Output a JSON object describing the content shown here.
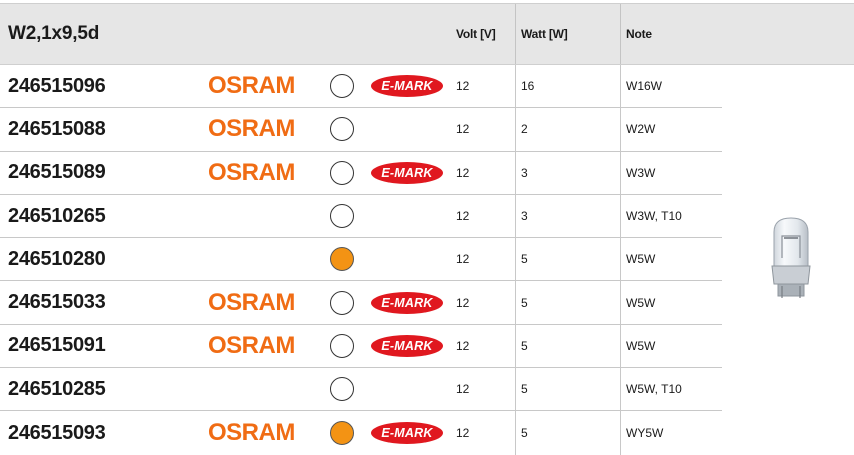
{
  "header": {
    "title": "W2,1x9,5d",
    "volt_label": "Volt [V]",
    "watt_label": "Watt [W]",
    "note_label": "Note"
  },
  "rows": [
    {
      "part": "246515096",
      "brand": "OSRAM",
      "circle": "empty",
      "emark": "E-MARK",
      "volt": "12",
      "watt": "16",
      "note": "W16W"
    },
    {
      "part": "246515088",
      "brand": "OSRAM",
      "circle": "empty",
      "emark": "",
      "volt": "12",
      "watt": "2",
      "note": "W2W"
    },
    {
      "part": "246515089",
      "brand": "OSRAM",
      "circle": "empty",
      "emark": "E-MARK",
      "volt": "12",
      "watt": "3",
      "note": "W3W"
    },
    {
      "part": "246510265",
      "brand": "",
      "circle": "empty",
      "emark": "",
      "volt": "12",
      "watt": "3",
      "note": "W3W, T10"
    },
    {
      "part": "246510280",
      "brand": "",
      "circle": "orange",
      "emark": "",
      "volt": "12",
      "watt": "5",
      "note": "W5W"
    },
    {
      "part": "246515033",
      "brand": "OSRAM",
      "circle": "empty",
      "emark": "E-MARK",
      "volt": "12",
      "watt": "5",
      "note": "W5W"
    },
    {
      "part": "246515091",
      "brand": "OSRAM",
      "circle": "empty",
      "emark": "E-MARK",
      "volt": "12",
      "watt": "5",
      "note": "W5W"
    },
    {
      "part": "246510285",
      "brand": "",
      "circle": "empty",
      "emark": "",
      "volt": "12",
      "watt": "5",
      "note": "W5W, T10"
    },
    {
      "part": "246515093",
      "brand": "OSRAM",
      "circle": "orange",
      "emark": "E-MARK",
      "volt": "12",
      "watt": "5",
      "note": "WY5W"
    }
  ],
  "colors": {
    "brand": "#f06c14",
    "emark": "#e0181f",
    "circle_orange": "#f39314",
    "header_bg": "#e6e6e6"
  },
  "image": {
    "icon": "wedge-bulb-image"
  }
}
